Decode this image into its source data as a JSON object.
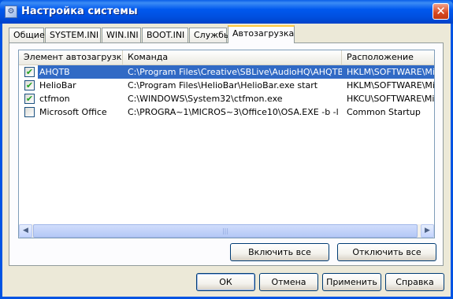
{
  "window": {
    "title": "Настройка системы",
    "close_label": "✕"
  },
  "tabs": [
    {
      "label": "Общие"
    },
    {
      "label": "SYSTEM.INI"
    },
    {
      "label": "WIN.INI"
    },
    {
      "label": "BOOT.INI"
    },
    {
      "label": "Службы"
    },
    {
      "label": "Автозагрузка",
      "active": true
    }
  ],
  "startup_list": {
    "columns": [
      "Элемент автозагрузки",
      "Команда",
      "Расположение"
    ],
    "rows": [
      {
        "checked": true,
        "name": "AHQTB",
        "command": "C:\\Program Files\\Creative\\SBLive\\AudioHQ\\AHQTB.EXE",
        "location": "HKLM\\SOFTWARE\\Microsoft\\Windows\\CurrentVersion\\Run",
        "selected": true
      },
      {
        "checked": true,
        "name": "HelioBar",
        "command": "C:\\Program Files\\HelioBar\\HelioBar.exe start",
        "location": "HKLM\\SOFTWARE\\Microsoft\\Windows\\CurrentVersion\\Run"
      },
      {
        "checked": true,
        "name": "ctfmon",
        "command": "C:\\WINDOWS\\System32\\ctfmon.exe",
        "location": "HKCU\\SOFTWARE\\Microsoft\\Windows\\CurrentVersion\\Run"
      },
      {
        "checked": false,
        "name": "Microsoft Office",
        "command": "C:\\PROGRA~1\\MICROS~3\\Office10\\OSA.EXE -b -l",
        "location": "Common Startup"
      }
    ],
    "check_mark": "✔",
    "scroll_left": "◀",
    "scroll_right": "▶",
    "scroll_grip": "|||"
  },
  "panel_buttons": {
    "enable_all": "Включить все",
    "disable_all": "Отключить все"
  },
  "dialog_buttons": {
    "ok": "ОК",
    "cancel": "Отмена",
    "apply": "Применить",
    "help": "Справка"
  }
}
